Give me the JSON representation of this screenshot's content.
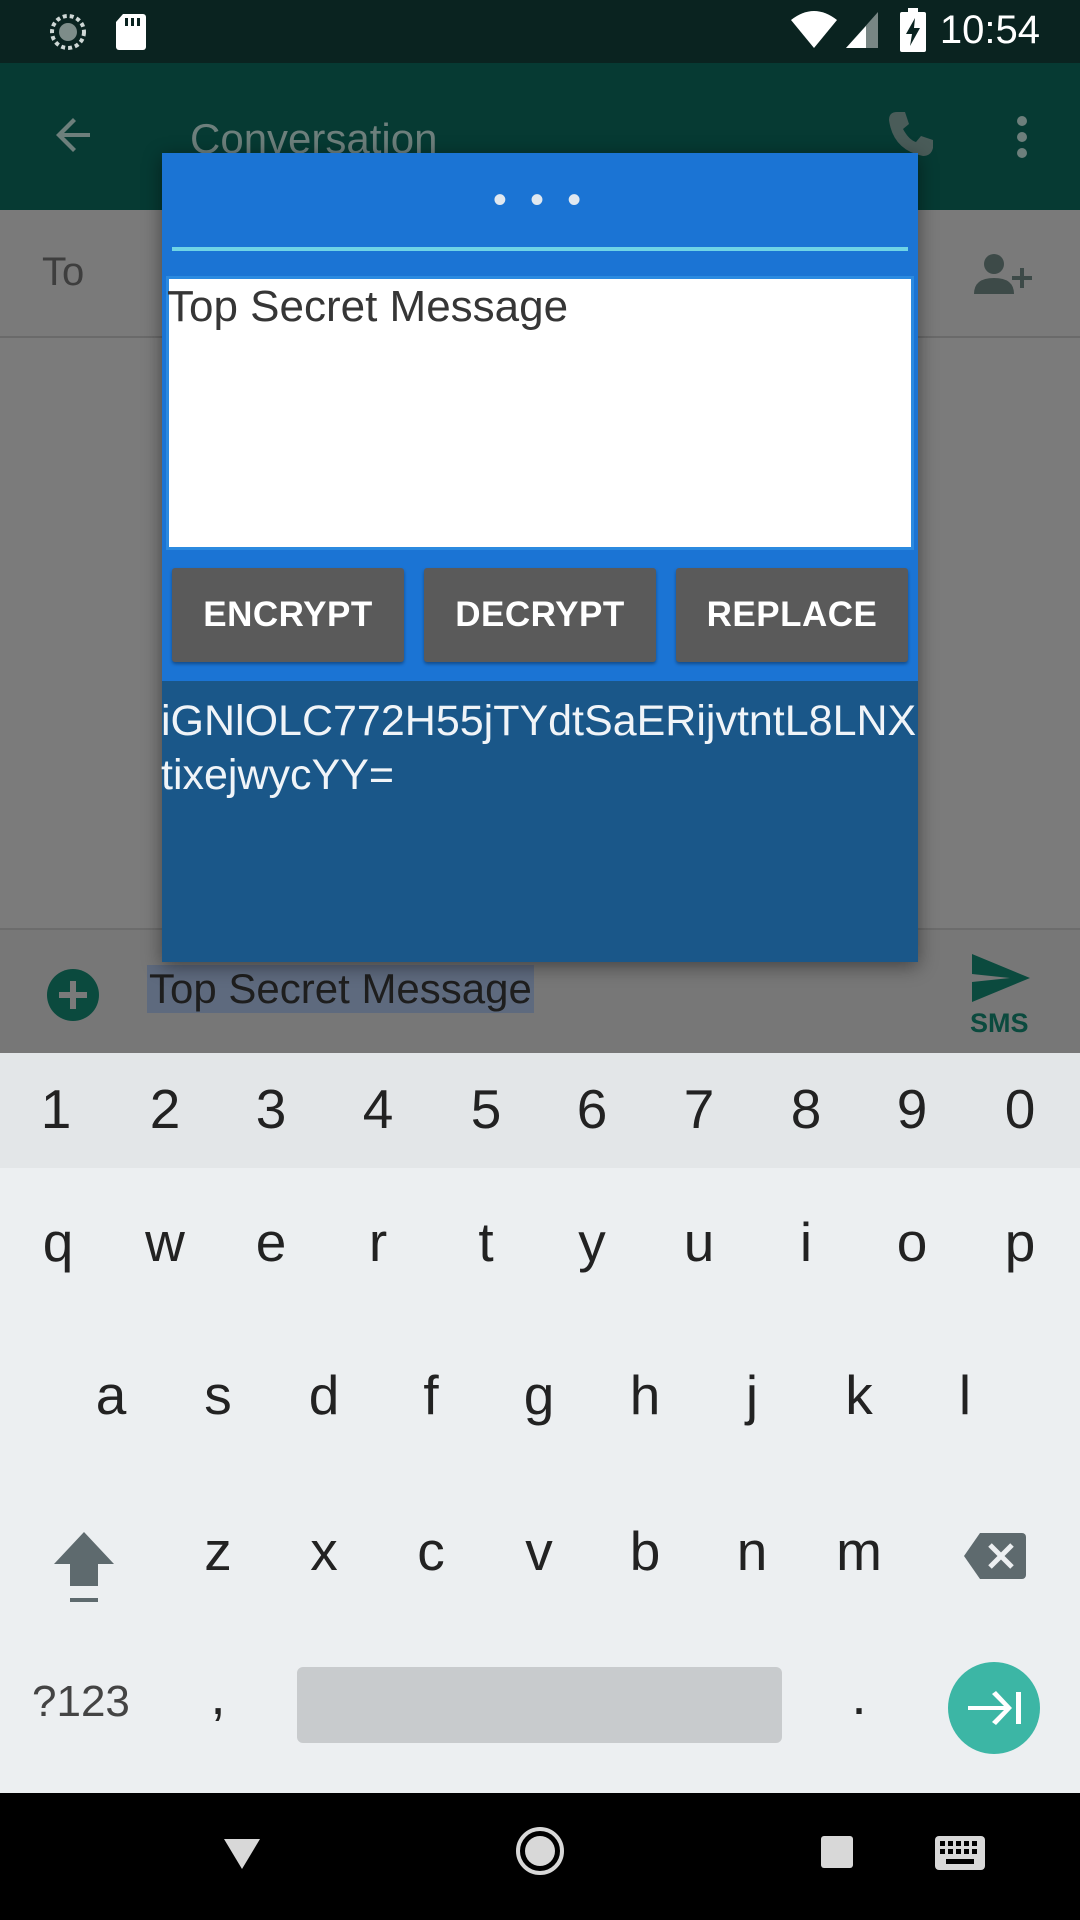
{
  "status_bar": {
    "time": "10:54",
    "left_icons": [
      "sync-icon",
      "sd-card-icon"
    ],
    "right_icons": [
      "wifi-icon",
      "signal-icon",
      "battery-charging-icon"
    ]
  },
  "app_bar": {
    "title": "Conversation",
    "icons": [
      "back-arrow-icon",
      "phone-icon",
      "more-vert-icon"
    ]
  },
  "recipient_bar": {
    "label": "To",
    "icon": "add-contact-icon"
  },
  "composer": {
    "message_text": "Top Secret Message",
    "send_label": "SMS",
    "icons": [
      "add-attachment-icon",
      "send-icon"
    ]
  },
  "dialog": {
    "title": "• • •",
    "input_text": "Top Secret Message",
    "buttons": {
      "encrypt": "ENCRYPT",
      "decrypt": "DECRYPT",
      "replace": "REPLACE"
    },
    "output_text": "iGNlOLC772H55jTYdtSaERijvtntL8LNXtixejwycYY="
  },
  "keyboard": {
    "number_row": [
      "1",
      "2",
      "3",
      "4",
      "5",
      "6",
      "7",
      "8",
      "9",
      "0"
    ],
    "row1": [
      "q",
      "w",
      "e",
      "r",
      "t",
      "y",
      "u",
      "i",
      "o",
      "p"
    ],
    "row2": [
      "a",
      "s",
      "d",
      "f",
      "g",
      "h",
      "j",
      "k",
      "l"
    ],
    "row3": [
      "z",
      "x",
      "c",
      "v",
      "b",
      "n",
      "m"
    ],
    "symbols_key": "?123",
    "comma_key": ",",
    "period_key": ".",
    "accent_color": "#3cb6a5"
  },
  "nav_bar": {
    "icons": [
      "back-triangle-icon",
      "home-circle-icon",
      "recents-square-icon",
      "keyboard-icon"
    ]
  }
}
